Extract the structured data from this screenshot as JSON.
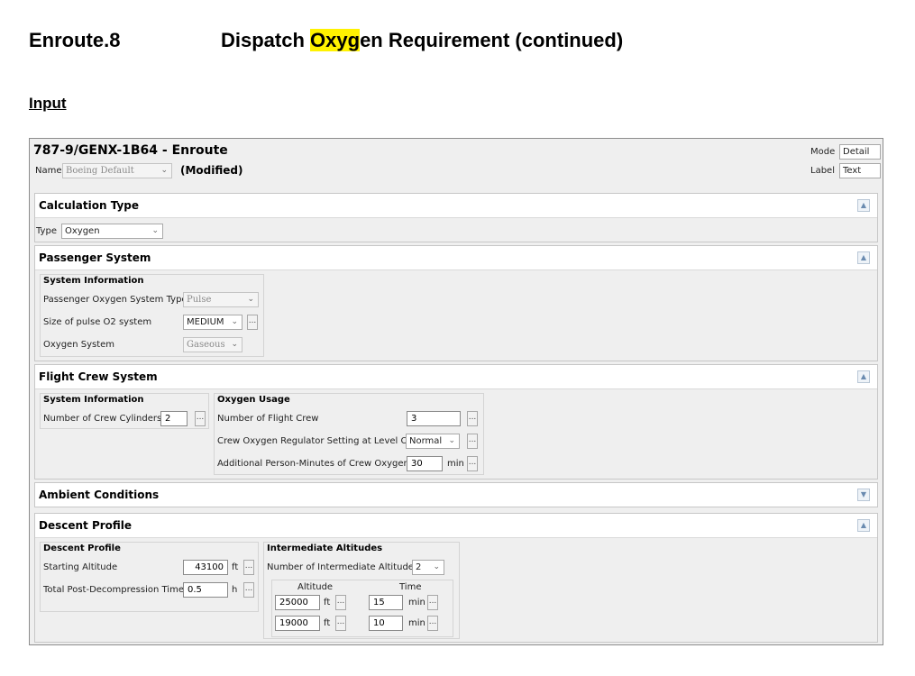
{
  "doc": {
    "section_id": "Enroute.8",
    "title_pre": "Dispatch ",
    "title_hl": "Oxyg",
    "title_post": "en Requirement (continued)",
    "input_heading": "Input"
  },
  "header": {
    "title": "787-9/GENX-1B64 - Enroute",
    "name_label": "Name",
    "name_value": "Boeing Default",
    "modified": "(Modified)",
    "mode_label": "Mode",
    "mode_value": "Detail",
    "label_label": "Label",
    "label_value": "Text"
  },
  "calc": {
    "title": "Calculation Type",
    "type_label": "Type",
    "type_value": "Oxygen"
  },
  "passenger": {
    "title": "Passenger System",
    "group": "System Information",
    "system_type_label": "Passenger Oxygen System Type",
    "system_type_value": "Pulse",
    "pulse_size_label": "Size of pulse O2 system",
    "pulse_size_value": "MEDIUM",
    "oxygen_system_label": "Oxygen System",
    "oxygen_system_value": "Gaseous"
  },
  "crew": {
    "title": "Flight Crew System",
    "group_sys": "System Information",
    "cylinders_label": "Number of Crew Cylinders",
    "cylinders_value": "2",
    "group_usage": "Oxygen Usage",
    "flight_crew_label": "Number of Flight Crew",
    "flight_crew_value": "3",
    "regulator_label": "Crew Oxygen Regulator Setting at Level Off",
    "regulator_value": "Normal",
    "person_minutes_label": "Additional Person-Minutes of Crew Oxygen",
    "person_minutes_value": "30",
    "person_minutes_unit": "min"
  },
  "ambient": {
    "title": "Ambient Conditions"
  },
  "descent": {
    "title": "Descent Profile",
    "group_profile": "Descent Profile",
    "start_alt_label": "Starting Altitude",
    "start_alt_value": "43100",
    "start_alt_unit": "ft",
    "post_time_label": "Total Post-Decompression Time",
    "post_time_value": "0.5",
    "post_time_unit": "h",
    "group_inter": "Intermediate Altitudes",
    "num_inter_label": "Number of Intermediate Altitude(s)",
    "num_inter_value": "2",
    "col_altitude": "Altitude",
    "col_time": "Time",
    "rows": [
      {
        "altitude": "25000",
        "alt_unit": "ft",
        "time": "15",
        "time_unit": "min"
      },
      {
        "altitude": "19000",
        "alt_unit": "ft",
        "time": "10",
        "time_unit": "min"
      }
    ]
  },
  "ui": {
    "dots": "...",
    "highlight_color": "#fff200",
    "icons": {
      "expand": "chevron-up-icon",
      "collapse": "chevron-down-icon",
      "dropdown": "chevron-down-icon"
    }
  }
}
